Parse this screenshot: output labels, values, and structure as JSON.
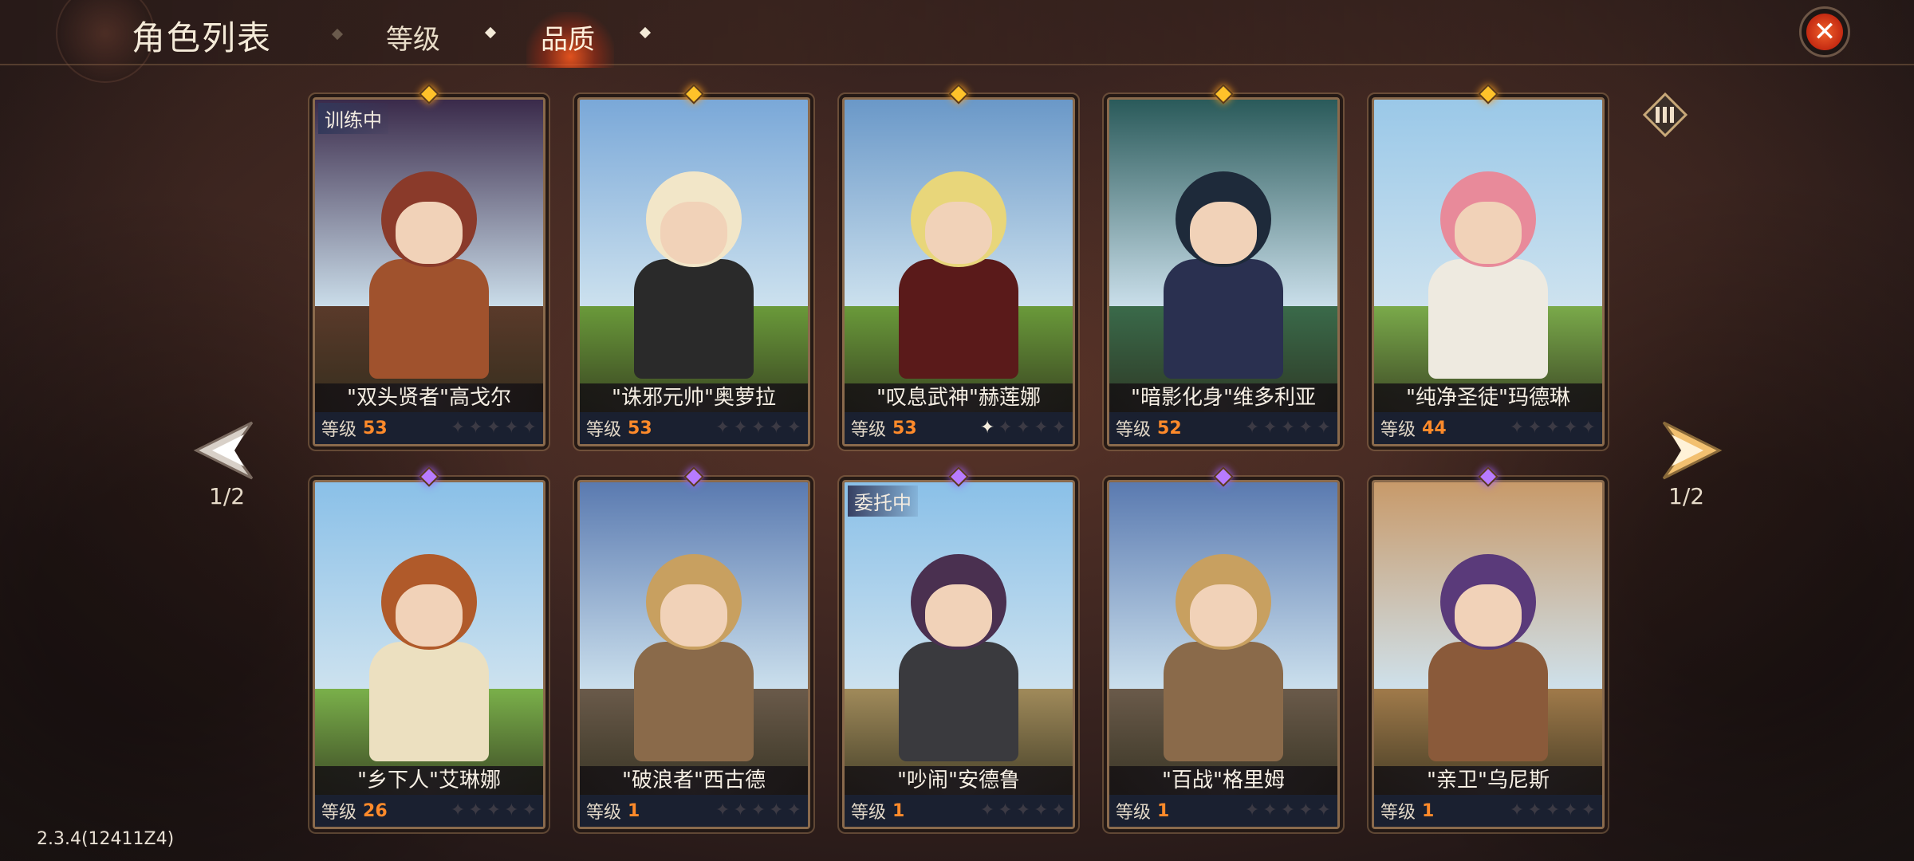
{
  "header": {
    "title": "角色列表",
    "tabs": [
      {
        "label": "等级",
        "active": false
      },
      {
        "label": "品质",
        "active": true
      }
    ],
    "close_icon": "close-icon"
  },
  "pagination": {
    "left_label": "1/2",
    "right_label": "1/2"
  },
  "level_prefix": "等级",
  "cards": [
    {
      "name": "\"双头贤者\"高戈尔",
      "level": "53",
      "stars_lit": 0,
      "gem": "gold",
      "status": "训练中",
      "palette": {
        "sky": "#3a2a4a",
        "ground": "#5a3a2a",
        "head": "#8a3a2a",
        "body": "#a0522d"
      }
    },
    {
      "name": "\"诛邪元帅\"奥萝拉",
      "level": "53",
      "stars_lit": 0,
      "gem": "gold",
      "status": "",
      "palette": {
        "sky": "#7aa8d8",
        "ground": "#6a9a3a",
        "head": "#f2e6c8",
        "body": "#2a2a2a"
      }
    },
    {
      "name": "\"叹息武神\"赫莲娜",
      "level": "53",
      "stars_lit": 1,
      "gem": "gold",
      "status": "",
      "palette": {
        "sky": "#6a98c8",
        "ground": "#6a9a3a",
        "head": "#e8d67a",
        "body": "#5a1a1a"
      }
    },
    {
      "name": "\"暗影化身\"维多利亚",
      "level": "52",
      "stars_lit": 0,
      "gem": "gold",
      "status": "",
      "palette": {
        "sky": "#2a5a5a",
        "ground": "#3a6a4a",
        "head": "#1e2a3a",
        "body": "#2a3050"
      }
    },
    {
      "name": "\"纯净圣徒\"玛德琳",
      "level": "44",
      "stars_lit": 0,
      "gem": "gold",
      "status": "",
      "palette": {
        "sky": "#9ac8e8",
        "ground": "#7aaa4a",
        "head": "#e88a9a",
        "body": "#eeeae0"
      }
    },
    {
      "name": "\"乡下人\"艾琳娜",
      "level": "26",
      "stars_lit": 0,
      "gem": "purple",
      "status": "",
      "palette": {
        "sky": "#8ac0e8",
        "ground": "#7ab04a",
        "head": "#b05a2a",
        "body": "#ece0c0"
      }
    },
    {
      "name": "\"破浪者\"西古德",
      "level": "1",
      "stars_lit": 0,
      "gem": "purple",
      "status": "",
      "palette": {
        "sky": "#5a7ab0",
        "ground": "#6a5a4a",
        "head": "#c8a060",
        "body": "#8a6a4a"
      }
    },
    {
      "name": "\"吵闹\"安德鲁",
      "level": "1",
      "stars_lit": 0,
      "gem": "purple",
      "status": "委托中",
      "palette": {
        "sky": "#8ac0e8",
        "ground": "#a08a5a",
        "head": "#4a3050",
        "body": "#3a3a3e"
      }
    },
    {
      "name": "\"百战\"格里姆",
      "level": "1",
      "stars_lit": 0,
      "gem": "purple",
      "status": "",
      "palette": {
        "sky": "#5a7ab0",
        "ground": "#6a5a4a",
        "head": "#c8a060",
        "body": "#8a6a4a"
      }
    },
    {
      "name": "\"亲卫\"乌尼斯",
      "level": "1",
      "stars_lit": 0,
      "gem": "purple",
      "status": "",
      "palette": {
        "sky": "#c89a6a",
        "ground": "#a07a4a",
        "head": "#5a3a7a",
        "body": "#8a5a3a"
      }
    }
  ],
  "version": "2.3.4(12411Z4)"
}
